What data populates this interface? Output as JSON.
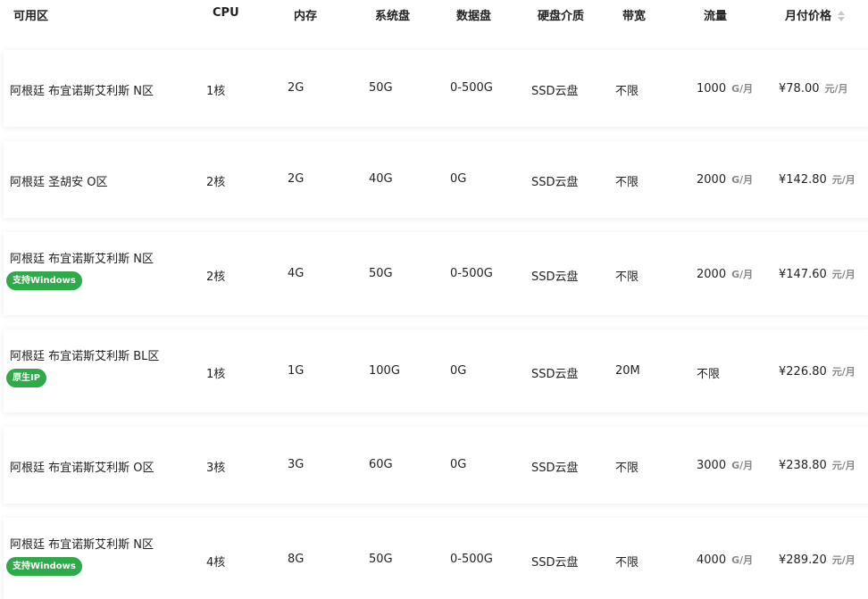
{
  "table": {
    "columns": {
      "zone": "可用区",
      "cpu": "CPU",
      "memory": "内存",
      "system_disk": "系统盘",
      "data_disk": "数据盘",
      "disk_type": "硬盘介质",
      "bandwidth": "带宽",
      "traffic": "流量",
      "price": "月付价格"
    },
    "rows": [
      {
        "zone": "阿根廷 布宜诺斯艾利斯 N区",
        "badge": "",
        "cpu": "1核",
        "memory": "2G",
        "system_disk": "50G",
        "data_disk": "0-500G",
        "disk_type": "SSD云盘",
        "bandwidth": "不限",
        "traffic": "1000",
        "traffic_unit": "G/月",
        "price": "¥78.00",
        "price_unit": "元/月"
      },
      {
        "zone": "阿根廷 圣胡安 O区",
        "badge": "",
        "cpu": "2核",
        "memory": "2G",
        "system_disk": "40G",
        "data_disk": "0G",
        "disk_type": "SSD云盘",
        "bandwidth": "不限",
        "traffic": "2000",
        "traffic_unit": "G/月",
        "price": "¥142.80",
        "price_unit": "元/月"
      },
      {
        "zone": "阿根廷 布宜诺斯艾利斯 N区",
        "badge": "支持Windows",
        "cpu": "2核",
        "memory": "4G",
        "system_disk": "50G",
        "data_disk": "0-500G",
        "disk_type": "SSD云盘",
        "bandwidth": "不限",
        "traffic": "2000",
        "traffic_unit": "G/月",
        "price": "¥147.60",
        "price_unit": "元/月"
      },
      {
        "zone": "阿根廷 布宜诺斯艾利斯 BL区",
        "badge": "原生IP",
        "cpu": "1核",
        "memory": "1G",
        "system_disk": "100G",
        "data_disk": "0G",
        "disk_type": "SSD云盘",
        "bandwidth": "20M",
        "traffic": "不限",
        "traffic_unit": "",
        "price": "¥226.80",
        "price_unit": "元/月"
      },
      {
        "zone": "阿根廷 布宜诺斯艾利斯 O区",
        "badge": "",
        "cpu": "3核",
        "memory": "3G",
        "system_disk": "60G",
        "data_disk": "0G",
        "disk_type": "SSD云盘",
        "bandwidth": "不限",
        "traffic": "3000",
        "traffic_unit": "G/月",
        "price": "¥238.80",
        "price_unit": "元/月"
      },
      {
        "zone": "阿根廷 布宜诺斯艾利斯 N区",
        "badge": "支持Windows",
        "cpu": "4核",
        "memory": "8G",
        "system_disk": "50G",
        "data_disk": "0-500G",
        "disk_type": "SSD云盘",
        "bandwidth": "不限",
        "traffic": "4000",
        "traffic_unit": "G/月",
        "price": "¥289.20",
        "price_unit": "元/月"
      }
    ]
  },
  "colors": {
    "badge_green": "#2eaa4a",
    "sort_icon": "#c8c8c8"
  }
}
